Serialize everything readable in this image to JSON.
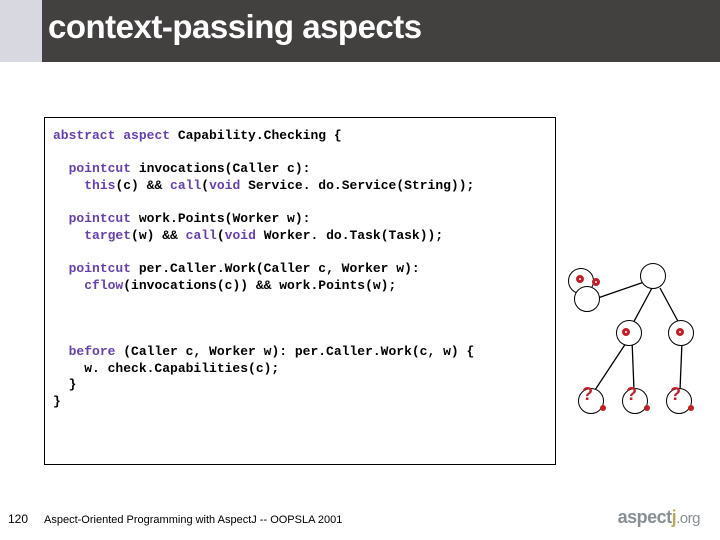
{
  "title": "context-passing aspects",
  "code_lines": [
    {
      "t": "abstract aspect Capability.Checking {",
      "k": false
    },
    {
      "t": "",
      "k": false
    },
    {
      "t": "  pointcut invocations(Caller c):",
      "k": true,
      "kw": "pointcut"
    },
    {
      "t": "    this(c) && call(void Service. do.Service(String));",
      "k": true,
      "kw": "this"
    },
    {
      "t": "",
      "k": false
    },
    {
      "t": "  pointcut work.Points(Worker w):",
      "k": true,
      "kw": "pointcut"
    },
    {
      "t": "    target(w) && call(void Worker. do.Task(Task));",
      "k": true,
      "kw": "target"
    },
    {
      "t": "",
      "k": false
    },
    {
      "t": "  pointcut per.Caller.Work(Caller c, Worker w):",
      "k": true,
      "kw": "pointcut"
    },
    {
      "t": "    cflow(invocations(c)) && work.Points(w);",
      "k": true,
      "kw": "cflow"
    },
    {
      "t": "",
      "k": false
    },
    {
      "t": "",
      "k": false
    },
    {
      "t": "",
      "k": false
    },
    {
      "t": "  before (Caller c, Worker w): per.Caller.Work(c, w) {",
      "k": true,
      "kw": "before"
    },
    {
      "t": "    w. check.Capabilities(c);",
      "k": false
    },
    {
      "t": "  }",
      "k": false
    },
    {
      "t": "}",
      "k": false
    }
  ],
  "slide_number": "120",
  "footer": "Aspect-Oriented Programming with AspectJ -- OOPSLA 2001",
  "logo": {
    "a": "aspect",
    "j": "j",
    "org": ".org"
  },
  "diagram": {
    "qmarks": [
      "?",
      "?",
      "?"
    ]
  }
}
